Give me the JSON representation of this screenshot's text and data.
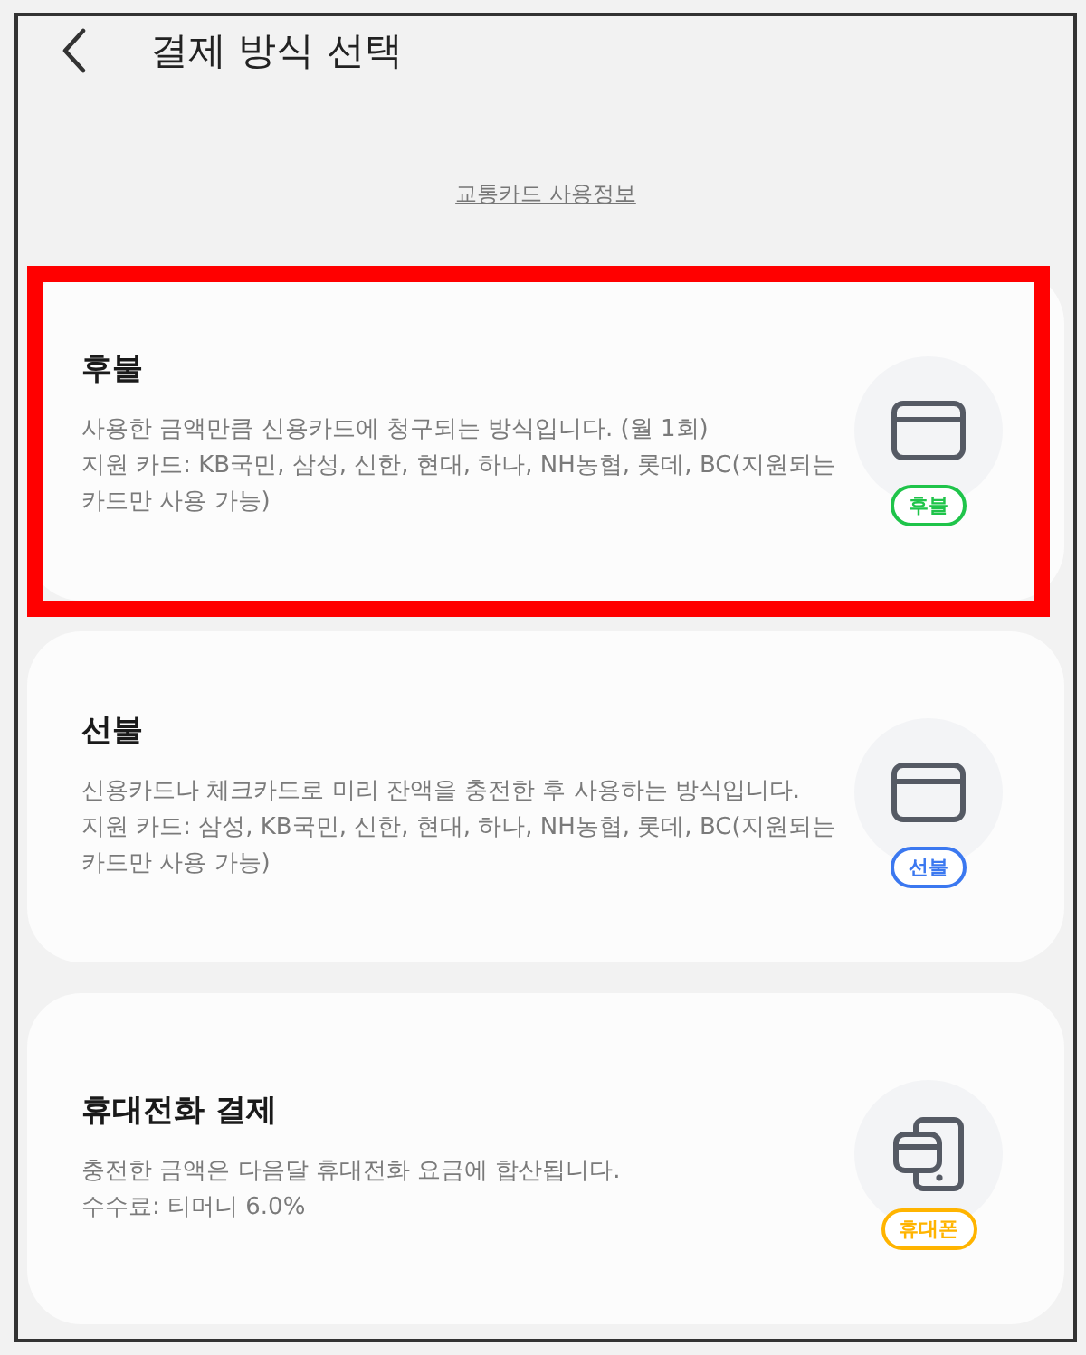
{
  "header": {
    "title": "결제 방식 선택"
  },
  "info_link": "교통카드 사용정보",
  "options": [
    {
      "kind": "card",
      "title": "후불",
      "description": [
        "사용한 금액만큼 신용카드에 청구되는 방식입니다. (월 1회)",
        "지원 카드: KB국민, 삼성, 신한, 현대, 하나, NH농협, 롯데, BC(지원되는 카드만 사용 가능)"
      ],
      "badge": {
        "label": "후불",
        "color": "#1fc44a"
      },
      "highlighted": true
    },
    {
      "kind": "card",
      "title": "선불",
      "description": [
        "신용카드나 체크카드로 미리 잔액을 충전한 후 사용하는 방식입니다.",
        "지원 카드: 삼성, KB국민, 신한, 현대, 하나, NH농협, 롯데, BC(지원되는 카드만 사용 가능)"
      ],
      "badge": {
        "label": "선불",
        "color": "#3b78f0"
      },
      "highlighted": false
    },
    {
      "kind": "phone",
      "title": "휴대전화 결제",
      "description": [
        "충전한 금액은 다음달 휴대전화 요금에 합산됩니다.",
        "수수료: 티머니 6.0%"
      ],
      "badge": {
        "label": "휴대폰",
        "color": "#ffb400"
      },
      "highlighted": false
    }
  ]
}
